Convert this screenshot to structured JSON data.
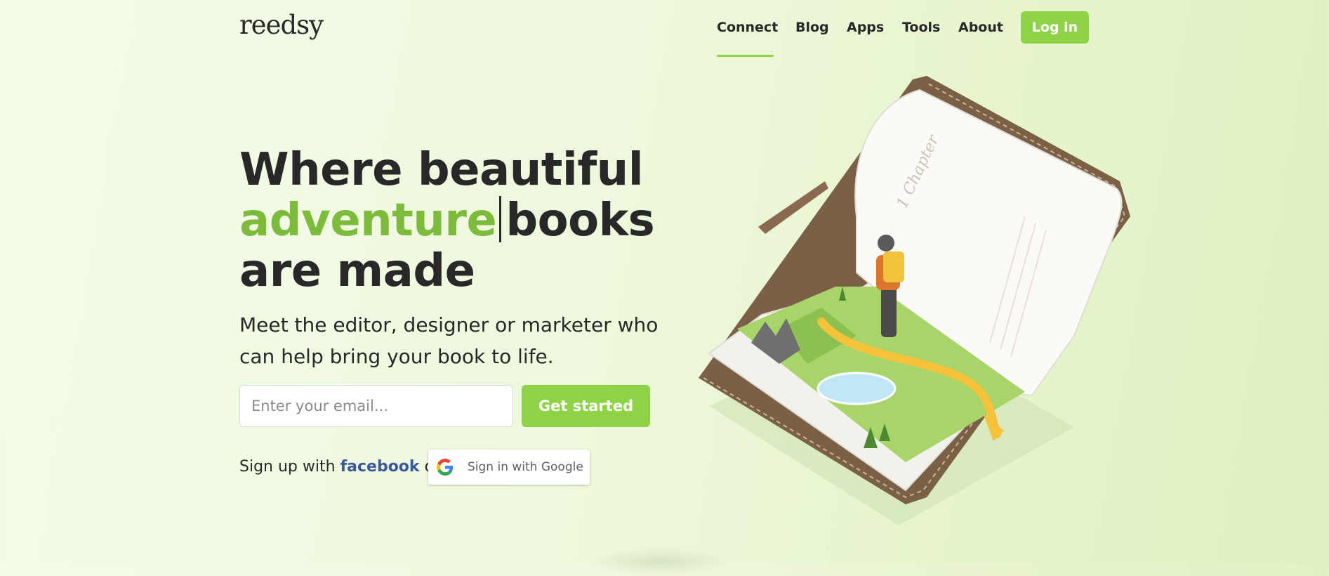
{
  "header": {
    "logo": "reedsy",
    "nav": [
      "Connect",
      "Blog",
      "Apps",
      "Tools",
      "About"
    ],
    "active_nav": "Connect",
    "login_label": "Log in"
  },
  "hero": {
    "headline_line1": "Where beautiful",
    "headline_accent": "adventure",
    "headline_line2_rest": "books",
    "headline_line3": "are made",
    "subhead": "Meet the editor, designer or marketer who can help bring your book to life.",
    "email_placeholder": "Enter your email...",
    "cta_label": "Get started",
    "signup_prefix": "Sign up with",
    "facebook_label": "facebook",
    "or_label": "or",
    "google_label": "Sign in with Google"
  },
  "illustration": {
    "page_text": "1 Chapter"
  },
  "colors": {
    "brand_green": "#8ed346",
    "accent_text": "#7cbb3c",
    "facebook_blue": "#3b5998",
    "text_dark": "#282828"
  }
}
